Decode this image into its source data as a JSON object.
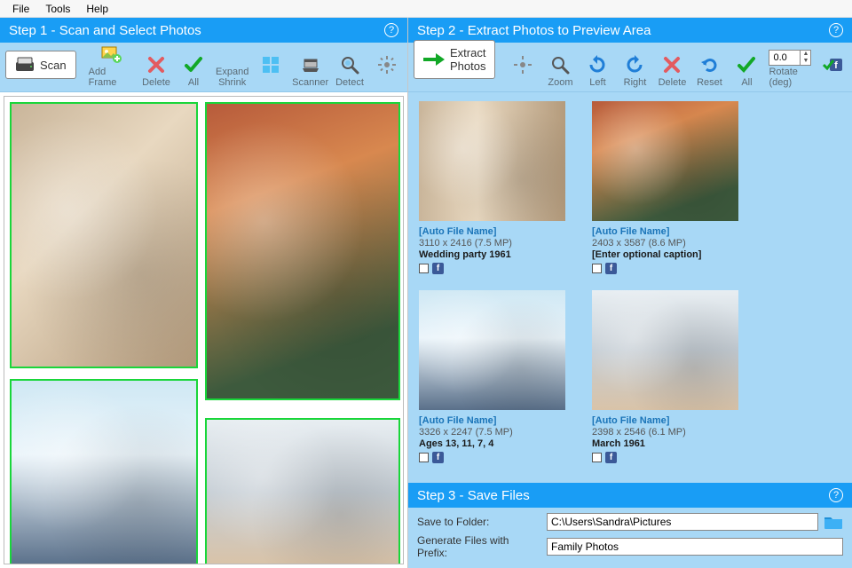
{
  "menu": {
    "file": "File",
    "tools": "Tools",
    "help": "Help"
  },
  "step1": {
    "title": "Step 1 - Scan and Select Photos",
    "scan": "Scan",
    "add_frame": "Add Frame",
    "delete": "Delete",
    "all": "All",
    "expand": "Expand",
    "shrink": "Shrink",
    "scanner": "Scanner",
    "detect": "Detect",
    "settings_icon": "gear"
  },
  "step2": {
    "title": "Step 2 - Extract Photos to Preview Area",
    "extract": "Extract Photos",
    "zoom": "Zoom",
    "left": "Left",
    "right": "Right",
    "delete": "Delete",
    "reset": "Reset",
    "all": "All",
    "rotate_label": "Rotate (deg)",
    "rotate_value": "0.0",
    "previews": [
      {
        "filename": "[Auto File Name]",
        "dims": "3110 x 2416 (7.5 MP)",
        "caption": "Wedding party 1961"
      },
      {
        "filename": "[Auto File Name]",
        "dims": "2403 x 3587 (8.6 MP)",
        "caption": "[Enter optional caption]"
      },
      {
        "filename": "[Auto File Name]",
        "dims": "3326 x 2247 (7.5 MP)",
        "caption": "Ages 13, 11, 7, 4"
      },
      {
        "filename": "[Auto File Name]",
        "dims": "2398 x 2546 (6.1 MP)",
        "caption": "March 1961"
      }
    ]
  },
  "step3": {
    "title": "Step 3 - Save Files",
    "save_to_label": "Save to Folder:",
    "save_to_value": "C:\\Users\\Sandra\\Pictures",
    "prefix_label": "Generate Files with Prefix:",
    "prefix_value": "Family Photos"
  }
}
